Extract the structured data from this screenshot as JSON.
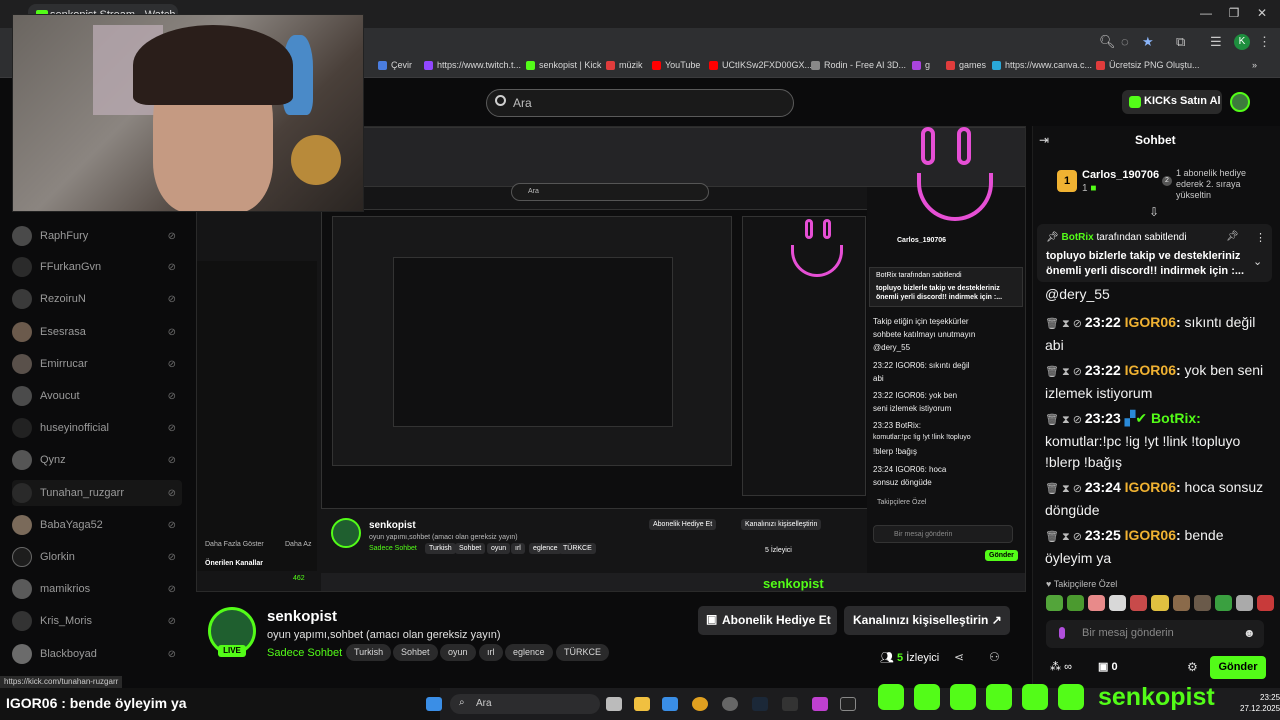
{
  "browser": {
    "tab_title": "senkopist Stream - Watch Live",
    "bookmarks": [
      {
        "label": "Çevir",
        "color": "#4a7de0"
      },
      {
        "label": "https://www.twitch.t...",
        "color": "#9147ff"
      },
      {
        "label": "senkopist | Kick",
        "color": "#53fc18"
      },
      {
        "label": "müzik",
        "color": "#e03c3c"
      },
      {
        "label": "YouTube",
        "color": "#ff0000"
      },
      {
        "label": "UCtIKSw2FXD00GX...",
        "color": "#ff0000"
      },
      {
        "label": "Rodin - Free AI 3D...",
        "color": "#888888"
      },
      {
        "label": "g",
        "color": "#aa44dd"
      },
      {
        "label": "games",
        "color": "#e03c3c"
      },
      {
        "label": "https://www.canva.c...",
        "color": "#2aa8d8"
      },
      {
        "label": "Ücretsiz PNG Oluştu...",
        "color": "#e03c3c"
      }
    ],
    "profile_initial": "K"
  },
  "header": {
    "search_placeholder": "Ara",
    "buy_kicks": "KICKs Satın Al"
  },
  "sidebar": {
    "items": [
      {
        "label": "RaphFury"
      },
      {
        "label": "FFurkanGvn"
      },
      {
        "label": "RezoiruN"
      },
      {
        "label": "Esesrasa"
      },
      {
        "label": "Emirrucar"
      },
      {
        "label": "Avoucut"
      },
      {
        "label": "huseyinofficial"
      },
      {
        "label": "Qynz"
      },
      {
        "label": "Tunahan_ruzgarr"
      },
      {
        "label": "BabaYaga52"
      },
      {
        "label": "Glorkin"
      },
      {
        "label": "mamikrios"
      },
      {
        "label": "Kris_Moris"
      },
      {
        "label": "Blackboyad"
      }
    ]
  },
  "stream_inner": {
    "chat_title": "Sohbet",
    "gift_user": "Carlos_190706",
    "pin_text": "BotRix tarafından sabitlendi",
    "pin_body": "topluyo bizlerle takip ve destekleriniz önemli yerli discord!! indirmek için :...",
    "lines": [
      "Takip etiğin için teşekkürler",
      "sohbete katılmayı unutmayın",
      "@dery_55",
      "23:22 IGOR06: sıkıntı değil",
      "abi",
      "23:22 IGOR06: yok ben",
      "seni izlemek istiyorum",
      "23:23 BotRix:",
      "komutlar:!pc !ig !yt !link !topluyo",
      "!blerp !bağış",
      "23:24 IGOR06: hoca",
      "sonsuz döngüde"
    ],
    "followers_only": "Takipçilere Özel",
    "input_placeholder": "Bir mesaj gönderin",
    "send": "Gönder",
    "channel": "senkopist",
    "title": "oyun yapımı,sohbet (amacı olan gereksiz yayın)",
    "category": "Sadece Sohbet",
    "tags": [
      "Turkish",
      "Sohbet",
      "oyun",
      "ırl",
      "eglence",
      "TÜRKCE"
    ],
    "sub_gift": "Abonelik Hediye Et",
    "customize": "Kanalınızı kişiselleştirin",
    "viewers": "5 İzleyici",
    "recommended": "Önerilen Kanallar",
    "show_more": "Daha Fazla Göster",
    "show_less": "Daha Az",
    "mini_viewers": "462",
    "taskbar_search": "Ara",
    "social_name": "senkopist"
  },
  "channel": {
    "name": "senkopist",
    "title": "oyun yapımı,sohbet (amacı olan gereksiz yayın)",
    "category": "Sadece Sohbet",
    "tags": [
      "Turkish",
      "Sohbet",
      "oyun",
      "ırl",
      "eglence",
      "TÜRKCE"
    ],
    "live": "LIVE",
    "sub_gift_button": "Abonelik Hediye Et",
    "customize_button": "Kanalınızı kişiselleştirin",
    "viewer_count": "5",
    "viewer_label": "İzleyici"
  },
  "chat": {
    "title": "Sohbet",
    "gift_rank": "1",
    "gift_user": "Carlos_190706",
    "gift_count": "1",
    "gift_rank2": "2",
    "gift_text": "1 abonelik hediye ederek 2. sıraya yükseltin",
    "pinned_by": "BotRix",
    "pinned_by_suffix": "tarafından sabitlendi",
    "pinned_body": "topluyo bizlerle takip ve destekleriniz önemli yerli discord!! indirmek için :...",
    "mention_line": "@dery_55",
    "messages": [
      {
        "time": "23:22",
        "user": "IGOR06",
        "text": "sıkıntı değil abi",
        "color": "#f0b232"
      },
      {
        "time": "23:22",
        "user": "IGOR06",
        "text": "yok ben seni izlemek istiyorum",
        "color": "#f0b232"
      },
      {
        "time": "23:23",
        "user": "BotRix",
        "text": "komutlar:!pc !ig !yt !link !topluyo !blerp !bağış",
        "color": "#53fc18"
      },
      {
        "time": "23:24",
        "user": "IGOR06",
        "text": "hoca sonsuz döngüde",
        "color": "#f0b232"
      },
      {
        "time": "23:25",
        "user": "IGOR06",
        "text": "bende öyleyim ya",
        "color": "#f0b232"
      }
    ],
    "followers_only": "Takipçilere Özel",
    "input_placeholder": "Bir mesaj gönderin",
    "points": "∞",
    "gifts": "0",
    "send_button": "Gönder"
  },
  "overlay": {
    "ticker_user": "IGOR06",
    "ticker_text": ": bende öyleyim ya",
    "url_tooltip": "https://kick.com/tunahan-ruzgarr",
    "social_name": "senkopist"
  },
  "taskbar": {
    "search_placeholder": "Ara",
    "time": "23:25",
    "date": "27.12.2025"
  }
}
